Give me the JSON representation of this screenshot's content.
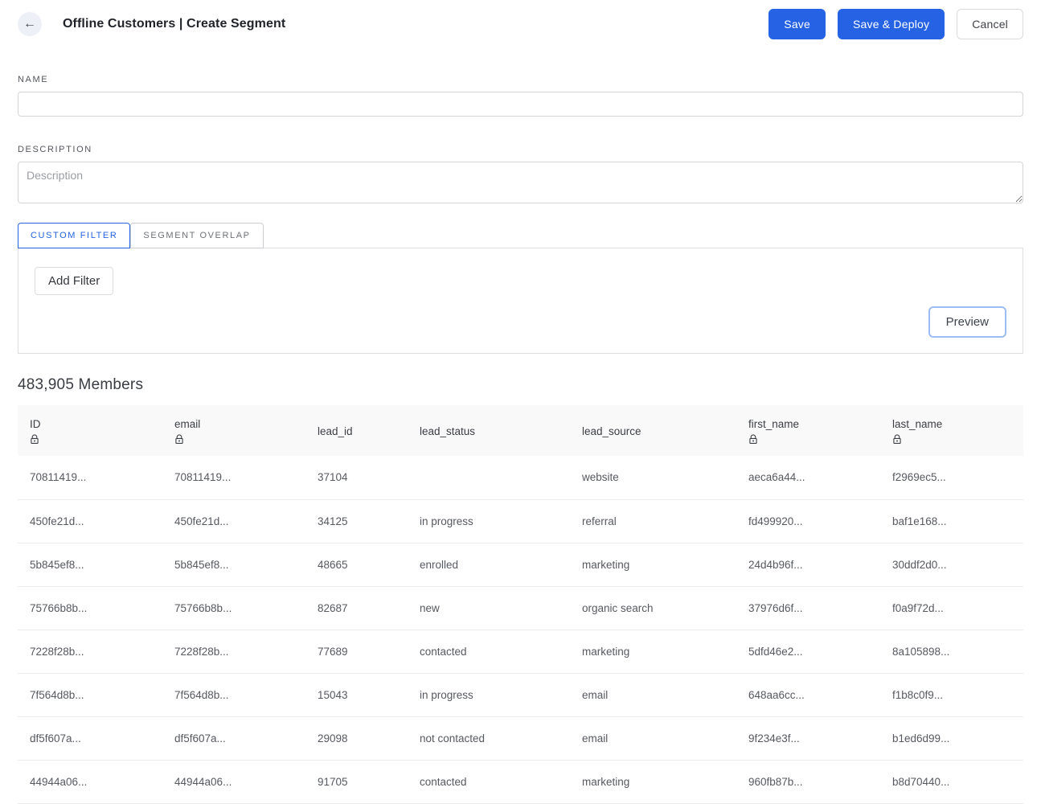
{
  "header": {
    "back_icon": "←",
    "title": "Offline Customers | Create Segment",
    "save_label": "Save",
    "save_deploy_label": "Save & Deploy",
    "cancel_label": "Cancel"
  },
  "form": {
    "name_label": "NAME",
    "name_value": "",
    "description_label": "DESCRIPTION",
    "description_placeholder": "Description"
  },
  "tabs": [
    {
      "label": "CUSTOM FILTER",
      "active": true
    },
    {
      "label": "SEGMENT OVERLAP",
      "active": false
    }
  ],
  "filter_panel": {
    "add_filter_label": "Add Filter",
    "preview_label": "Preview"
  },
  "members": {
    "count_text": "483,905 Members"
  },
  "table": {
    "columns": [
      {
        "label": "ID",
        "locked": true
      },
      {
        "label": "email",
        "locked": true
      },
      {
        "label": "lead_id",
        "locked": false
      },
      {
        "label": "lead_status",
        "locked": false
      },
      {
        "label": "lead_source",
        "locked": false
      },
      {
        "label": "first_name",
        "locked": true
      },
      {
        "label": "last_name",
        "locked": true
      }
    ],
    "rows": [
      [
        "70811419...",
        "70811419...",
        "37104",
        "",
        "website",
        "aeca6a44...",
        "f2969ec5..."
      ],
      [
        "450fe21d...",
        "450fe21d...",
        "34125",
        "in progress",
        "referral",
        "fd499920...",
        "baf1e168..."
      ],
      [
        "5b845ef8...",
        "5b845ef8...",
        "48665",
        "enrolled",
        "marketing",
        "24d4b96f...",
        "30ddf2d0..."
      ],
      [
        "75766b8b...",
        "75766b8b...",
        "82687",
        "new",
        "organic search",
        "37976d6f...",
        "f0a9f72d..."
      ],
      [
        "7228f28b...",
        "7228f28b...",
        "77689",
        "contacted",
        "marketing",
        "5dfd46e2...",
        "8a105898..."
      ],
      [
        "7f564d8b...",
        "7f564d8b...",
        "15043",
        "in progress",
        "email",
        "648aa6cc...",
        "f1b8c0f9..."
      ],
      [
        "df5f607a...",
        "df5f607a...",
        "29098",
        "not contacted",
        "email",
        "9f234e3f...",
        "b1ed6d99..."
      ],
      [
        "44944a06...",
        "44944a06...",
        "91705",
        "contacted",
        "marketing",
        "960fb87b...",
        "b8d70440..."
      ]
    ]
  },
  "colors": {
    "primary_blue": "#2563e4",
    "preview_border": "#9bbdf4",
    "table_header_bg": "#f9f9f9",
    "back_circle_bg": "#edf0f7"
  }
}
